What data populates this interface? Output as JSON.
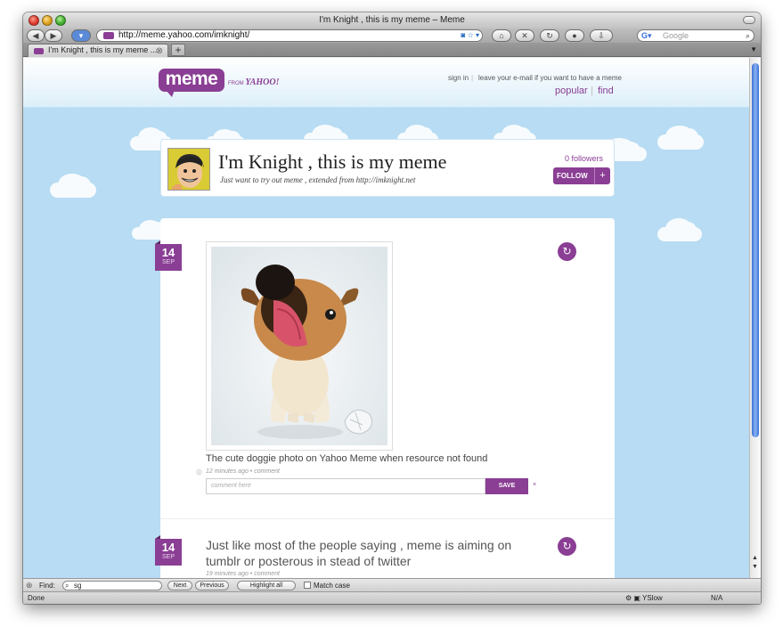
{
  "window": {
    "title": "I'm Knight , this is my meme – Meme"
  },
  "toolbar": {
    "back": "◀",
    "forward": "▶",
    "url": "http://meme.yahoo.com/imknight/",
    "search_placeholder": "Google"
  },
  "tabs": [
    {
      "label": "I'm Knight , this is my meme ..."
    }
  ],
  "site": {
    "logo": "meme",
    "from": "FROM",
    "from_brand": "YAHOO!",
    "signin": "sign in",
    "leave_email": "leave your e-mail if you want to have a meme",
    "nav_popular": "popular",
    "nav_find": "find"
  },
  "profile": {
    "title": "I'm Knight , this is my meme",
    "subtitle": "Just want to try out meme , extended from http://imknight.net",
    "followers": "0 followers",
    "follow_label": "FOLLOW",
    "follow_plus": "+"
  },
  "posts": [
    {
      "day": "14",
      "month": "SEP",
      "caption": "The cute doggie photo on Yahoo Meme when resource not found",
      "meta": "12 minutes ago • comment",
      "comment_placeholder": "comment here",
      "save_label": "SAVE",
      "cancel": "×"
    },
    {
      "day": "14",
      "month": "SEP",
      "text": "Just like most of the people saying , meme is aiming on tumblr or posterous in stead of twitter",
      "meta": "19 minutes ago • comment"
    }
  ],
  "findbar": {
    "label": "Find:",
    "value": "sg",
    "next": "Next",
    "previous": "Previous",
    "highlight": "Highlight all",
    "match_case": "Match case"
  },
  "statusbar": {
    "text": "Done",
    "yslow": "YSlow",
    "na": "N/A"
  },
  "colors": {
    "brand_purple": "#8a3e94",
    "sky": "#b7dcf3"
  }
}
